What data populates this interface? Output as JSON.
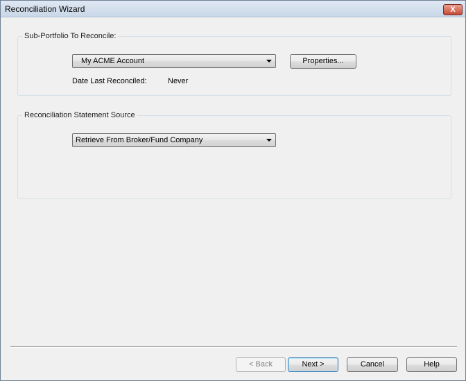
{
  "window": {
    "title": "Reconciliation Wizard",
    "close_label": "X"
  },
  "subportfolio": {
    "group_label": "Sub-Portfolio To Reconcile:",
    "selected_account": "My ACME Account",
    "properties_label": "Properties...",
    "date_label": "Date Last Reconciled:",
    "date_value": "Never"
  },
  "source": {
    "group_label": "Reconciliation Statement Source",
    "selected_source": "Retrieve From Broker/Fund Company"
  },
  "footer": {
    "back_label": "< Back",
    "next_label": "Next >",
    "cancel_label": "Cancel",
    "help_label": "Help"
  }
}
